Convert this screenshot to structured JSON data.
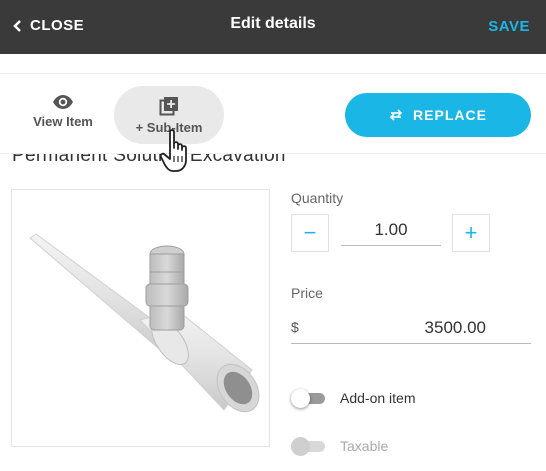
{
  "header": {
    "close_label": "CLOSE",
    "title": "Edit details",
    "save_label": "SAVE"
  },
  "actions": {
    "view_item_label": "View Item",
    "sub_item_label": "+ Sub-Item",
    "replace_label": "REPLACE"
  },
  "item": {
    "title": "Permanent Solution Excavation"
  },
  "quantity": {
    "label": "Quantity",
    "value": "1.00",
    "minus_symbol": "−",
    "plus_symbol": "+"
  },
  "price": {
    "label": "Price",
    "currency_symbol": "$",
    "value": "3500.00"
  },
  "toggles": {
    "add_on_label": "Add-on item",
    "add_on_on": false,
    "taxable_label": "Taxable",
    "taxable_on": false
  },
  "colors": {
    "accent": "#19b6e6",
    "header_bg": "#3a3a3a",
    "pill_bg": "#e9e9e9"
  },
  "icons": [
    "chevron-left-icon",
    "eye-icon",
    "add-box-icon",
    "swap-icon",
    "hand-pointer-icon"
  ]
}
